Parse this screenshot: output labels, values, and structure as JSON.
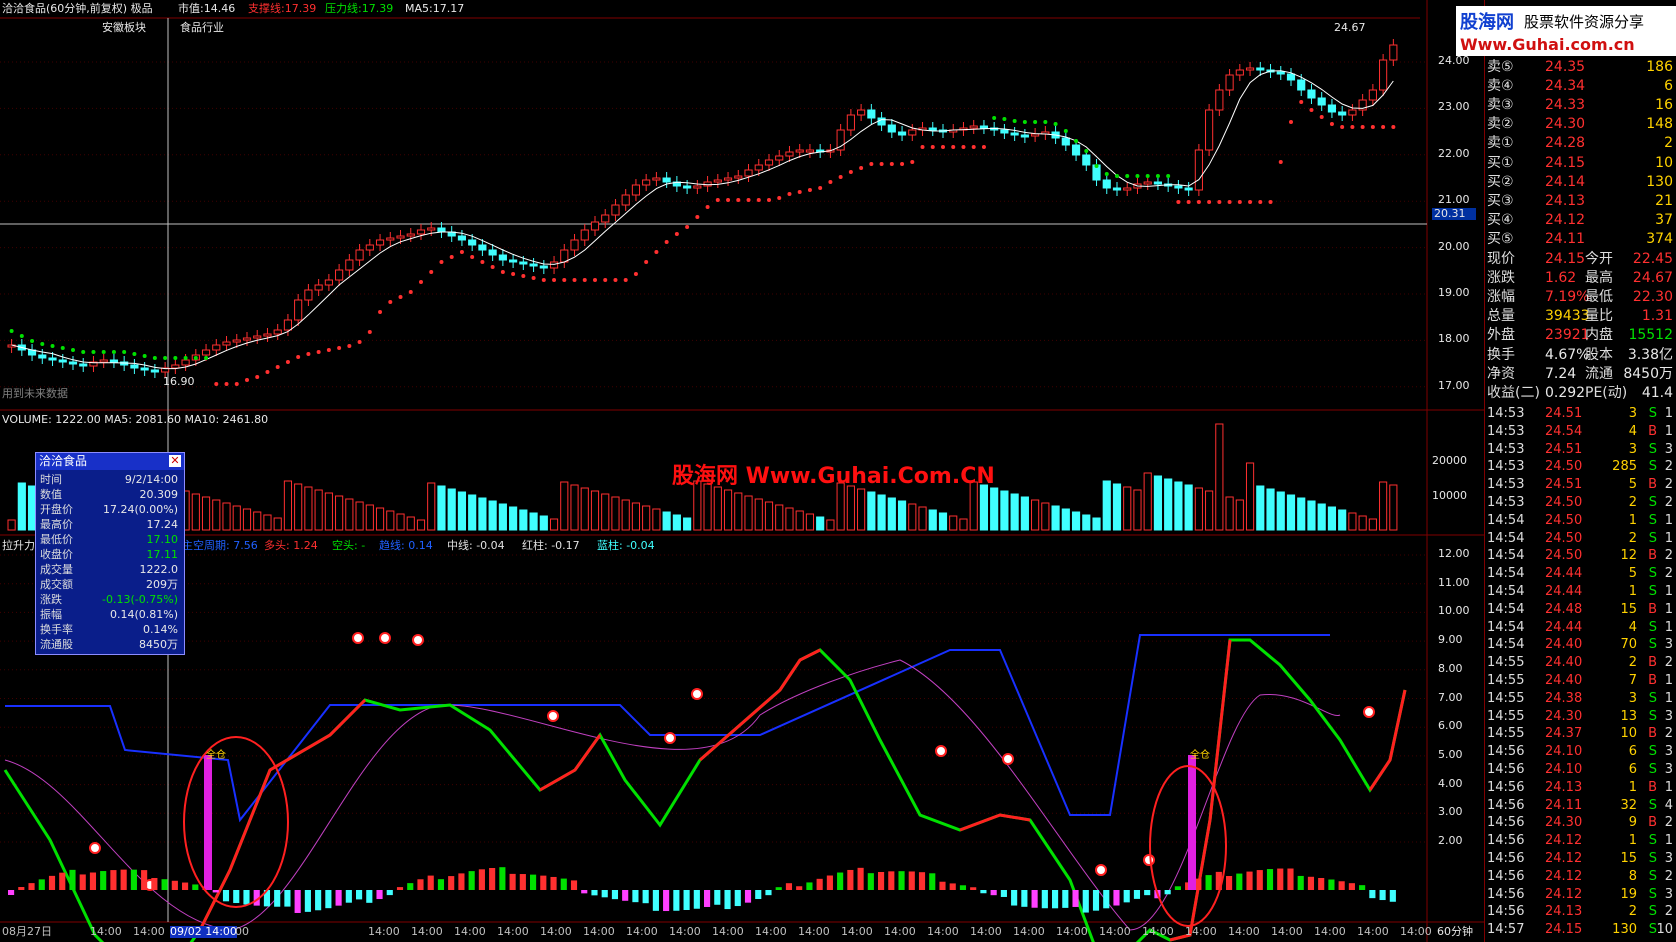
{
  "header": {
    "stock_name": "洽洽食品(60分钟,前复权) 极品",
    "mkt_cap": "市值:14.46",
    "support": "支撑线:17.39",
    "pressure": "压力线:17.39",
    "ma5": "MA5:17.17",
    "block1": "安徽板块",
    "block2": "食品行业",
    "high_mark": "24.67",
    "low_mark": "16.90",
    "future_note": "用到未来数据",
    "cursor_price": "20.31"
  },
  "price_axis": [
    "24.00",
    "23.00",
    "22.00",
    "21.00",
    "20.00",
    "19.00",
    "18.00",
    "17.00"
  ],
  "volume": {
    "label": "VOLUME: 1222.00  MA5: 2081.60  MA10: 2461.80",
    "axis": [
      "20000",
      "10000"
    ]
  },
  "indicator": {
    "name": "拉升力",
    "labels": [
      {
        "text": "主空周期: 7.56",
        "color": "#2060ff"
      },
      {
        "text": "多头: 1.24",
        "color": "#ff3030"
      },
      {
        "text": "空头: -",
        "color": "#00e000"
      },
      {
        "text": "趋线: 0.14",
        "color": "#2060ff"
      },
      {
        "text": "中线: -0.04",
        "color": "#e0e0e0"
      },
      {
        "text": "红柱: -0.17",
        "color": "#e0e0e0"
      },
      {
        "text": "蓝柱: -0.04",
        "color": "#40ffff"
      }
    ],
    "axis": [
      "12.00",
      "11.00",
      "10.00",
      "9.00",
      "8.00",
      "7.00",
      "6.00",
      "5.00",
      "4.00",
      "3.00",
      "2.00"
    ],
    "marker_text": "全仓"
  },
  "time_axis": [
    "08月27日",
    "14:00",
    "14:00",
    "09/02 14:00",
    "00",
    "14:00",
    "14:00",
    "14:00",
    "14:00",
    "14:00",
    "14:00",
    "14:00",
    "14:00",
    "14:00",
    "14:00",
    "14:00",
    "14:00",
    "14:00",
    "14:00",
    "14:00",
    "14:00",
    "14:00",
    "14:00",
    "14:00",
    "14:00",
    "14:00",
    "14:00",
    "14:00",
    "14:00",
    "14:00",
    "14:00",
    "14:00"
  ],
  "period": "60分钟",
  "watermark": "股海网 Www.Guhai.Com.CN",
  "logo": {
    "line1": "股海网",
    "line2": "股票软件资源分享",
    "line3": "Www.Guhai.com.cn"
  },
  "info": {
    "title": "洽洽食品",
    "rows": [
      {
        "k": "时间",
        "v": "9/2/14:00",
        "c": "#e8e8e8"
      },
      {
        "k": "数值",
        "v": "20.309",
        "c": "#e8e8e8"
      },
      {
        "k": "开盘价",
        "v": "17.24(0.00%)",
        "c": "#e8e8e8"
      },
      {
        "k": "最高价",
        "v": "17.24",
        "c": "#e8e8e8"
      },
      {
        "k": "最低价",
        "v": "17.10",
        "c": "#00e000"
      },
      {
        "k": "收盘价",
        "v": "17.11",
        "c": "#00e000"
      },
      {
        "k": "成交量",
        "v": "1222.0",
        "c": "#e8e8e8"
      },
      {
        "k": "成交额",
        "v": "209万",
        "c": "#e8e8e8"
      },
      {
        "k": "涨跌",
        "v": "-0.13(-0.75%)",
        "c": "#00e000"
      },
      {
        "k": "振幅",
        "v": "0.14(0.81%)",
        "c": "#e8e8e8"
      },
      {
        "k": "换手率",
        "v": "0.14%",
        "c": "#e8e8e8"
      },
      {
        "k": "流通股",
        "v": "8450万",
        "c": "#e8e8e8"
      }
    ]
  },
  "quote": {
    "asks": [
      {
        "k": "卖⑤",
        "p": "24.35",
        "v": "186"
      },
      {
        "k": "卖④",
        "p": "24.34",
        "v": "6"
      },
      {
        "k": "卖③",
        "p": "24.33",
        "v": "16"
      },
      {
        "k": "卖②",
        "p": "24.30",
        "v": "148"
      },
      {
        "k": "卖①",
        "p": "24.28",
        "v": "2"
      }
    ],
    "bids": [
      {
        "k": "买①",
        "p": "24.15",
        "v": "10"
      },
      {
        "k": "买②",
        "p": "24.14",
        "v": "130"
      },
      {
        "k": "买③",
        "p": "24.13",
        "v": "21"
      },
      {
        "k": "买④",
        "p": "24.12",
        "v": "37"
      },
      {
        "k": "买⑤",
        "p": "24.11",
        "v": "374"
      }
    ],
    "stats": [
      {
        "k1": "现价",
        "v1": "24.15",
        "c1": "#ff3030",
        "k2": "今开",
        "v2": "22.45",
        "c2": "#ff3030"
      },
      {
        "k1": "涨跌",
        "v1": "1.62",
        "c1": "#ff3030",
        "k2": "最高",
        "v2": "24.67",
        "c2": "#ff3030"
      },
      {
        "k1": "涨幅",
        "v1": "7.19%",
        "c1": "#ff3030",
        "k2": "最低",
        "v2": "22.30",
        "c2": "#ff3030"
      },
      {
        "k1": "总量",
        "v1": "39433",
        "c1": "#ffd200",
        "k2": "量比",
        "v2": "1.31",
        "c2": "#ff3030"
      },
      {
        "k1": "外盘",
        "v1": "23921",
        "c1": "#ff3030",
        "k2": "内盘",
        "v2": "15512",
        "c2": "#00e000"
      }
    ],
    "stats2": [
      {
        "k1": "换手",
        "v1": "4.67%",
        "k2": "股本",
        "v2": "3.38亿"
      },
      {
        "k1": "净资",
        "v1": "7.24",
        "k2": "流通",
        "v2": "8450万"
      },
      {
        "k1": "收益(二)",
        "v1": "0.292",
        "k2": "PE(动)",
        "v2": "41.4"
      }
    ],
    "ticks": [
      {
        "t": "14:53",
        "p": "24.51",
        "v": "3",
        "s": "S",
        "n": "1"
      },
      {
        "t": "14:53",
        "p": "24.54",
        "v": "4",
        "s": "B",
        "n": "1"
      },
      {
        "t": "14:53",
        "p": "24.51",
        "v": "3",
        "s": "S",
        "n": "3"
      },
      {
        "t": "14:53",
        "p": "24.50",
        "v": "285",
        "s": "S",
        "n": "2"
      },
      {
        "t": "14:53",
        "p": "24.51",
        "v": "5",
        "s": "B",
        "n": "2"
      },
      {
        "t": "14:53",
        "p": "24.50",
        "v": "2",
        "s": "S",
        "n": "2"
      },
      {
        "t": "14:54",
        "p": "24.50",
        "v": "1",
        "s": "S",
        "n": "1"
      },
      {
        "t": "14:54",
        "p": "24.50",
        "v": "2",
        "s": "S",
        "n": "1"
      },
      {
        "t": "14:54",
        "p": "24.50",
        "v": "12",
        "s": "B",
        "n": "2"
      },
      {
        "t": "14:54",
        "p": "24.44",
        "v": "5",
        "s": "S",
        "n": "2"
      },
      {
        "t": "14:54",
        "p": "24.44",
        "v": "1",
        "s": "S",
        "n": "1"
      },
      {
        "t": "14:54",
        "p": "24.48",
        "v": "15",
        "s": "B",
        "n": "1"
      },
      {
        "t": "14:54",
        "p": "24.44",
        "v": "4",
        "s": "S",
        "n": "1"
      },
      {
        "t": "14:54",
        "p": "24.40",
        "v": "70",
        "s": "S",
        "n": "3"
      },
      {
        "t": "14:55",
        "p": "24.40",
        "v": "2",
        "s": "B",
        "n": "2"
      },
      {
        "t": "14:55",
        "p": "24.40",
        "v": "7",
        "s": "B",
        "n": "1"
      },
      {
        "t": "14:55",
        "p": "24.38",
        "v": "3",
        "s": "S",
        "n": "1"
      },
      {
        "t": "14:55",
        "p": "24.30",
        "v": "13",
        "s": "S",
        "n": "3"
      },
      {
        "t": "14:55",
        "p": "24.37",
        "v": "10",
        "s": "B",
        "n": "2"
      },
      {
        "t": "14:56",
        "p": "24.10",
        "v": "6",
        "s": "S",
        "n": "3"
      },
      {
        "t": "14:56",
        "p": "24.10",
        "v": "6",
        "s": "S",
        "n": "3"
      },
      {
        "t": "14:56",
        "p": "24.13",
        "v": "1",
        "s": "B",
        "n": "1"
      },
      {
        "t": "14:56",
        "p": "24.11",
        "v": "32",
        "s": "S",
        "n": "4"
      },
      {
        "t": "14:56",
        "p": "24.30",
        "v": "9",
        "s": "B",
        "n": "2"
      },
      {
        "t": "14:56",
        "p": "24.12",
        "v": "1",
        "s": "S",
        "n": "1"
      },
      {
        "t": "14:56",
        "p": "24.12",
        "v": "15",
        "s": "S",
        "n": "3"
      },
      {
        "t": "14:56",
        "p": "24.12",
        "v": "8",
        "s": "S",
        "n": "2"
      },
      {
        "t": "14:56",
        "p": "24.12",
        "v": "19",
        "s": "S",
        "n": "3"
      },
      {
        "t": "14:56",
        "p": "24.13",
        "v": "2",
        "s": "S",
        "n": "2"
      },
      {
        "t": "14:57",
        "p": "24.15",
        "v": "130",
        "s": "S",
        "n": "10"
      }
    ]
  },
  "colors": {
    "up": "#ff3030",
    "down": "#40ffff",
    "grid": "#800000",
    "ma": "#ffffff"
  }
}
